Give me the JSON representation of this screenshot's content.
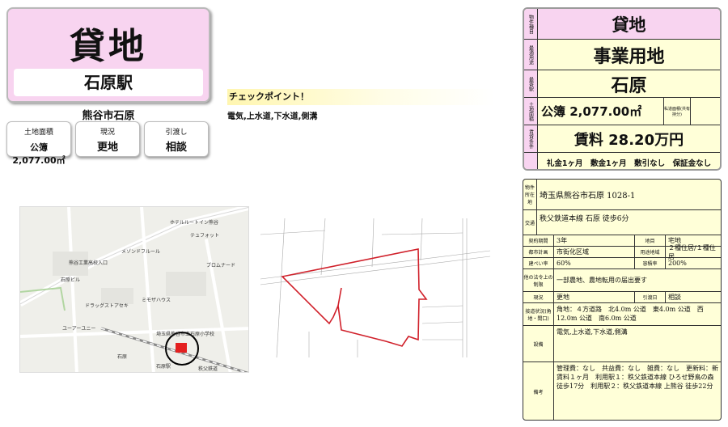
{
  "header": {
    "title": "貸地",
    "station": "石原駅",
    "location": "熊谷市石原"
  },
  "info_boxes": [
    {
      "label": "土地面積",
      "value": "公簿 2,077.00㎡"
    },
    {
      "label": "現況",
      "value": "更地"
    },
    {
      "label": "引渡し",
      "value": "相談"
    }
  ],
  "checkpoint": {
    "title": "チェックポイント！",
    "text": "電気,上水道,下水道,側溝"
  },
  "map_labels": [
    "ホテルルートイン熊谷",
    "テュフォット",
    "熊谷工業高校入口",
    "メゾンドフルール",
    "石原ビル",
    "ドラッグストアセキ",
    "ミモザハウス",
    "ブロムナード",
    "ユーアーユニー",
    "石原",
    "埼玉県熊谷市立石原小学校",
    "秩父鉄道",
    "石原駅"
  ],
  "spec": {
    "rows": [
      {
        "label": "物件種目",
        "value": "貸地"
      },
      {
        "label": "最適用途",
        "value": "事業用地"
      },
      {
        "label": "最寄駅",
        "value": "石原"
      },
      {
        "label": "土地面積",
        "value": "公簿 2,077.00㎡",
        "note": "私道面積(共有持分)"
      },
      {
        "label": "賃貸条件",
        "value": "賃料 28.20万円"
      },
      {
        "label": "",
        "value": "礼金1ヶ月　敷金1ヶ月　敷引なし　保証金なし"
      }
    ]
  },
  "detail": {
    "address_label": "物件所在地",
    "address": "埼玉県熊谷市石原 1028-1",
    "transport_label": "交通",
    "transport": "秩父鉄道本線 石原 徒歩6分",
    "contract_label": "契約期間",
    "contract": "3年",
    "land_label": "地目",
    "land": "宅地",
    "city_plan_label": "都市計画",
    "city_plan": "市街化区域",
    "zoning_label": "用途地域",
    "zoning": "２種住居/１種住居",
    "coverage_label": "建ぺい率",
    "coverage": "60%",
    "floor_ratio_label": "容積率",
    "floor_ratio": "200%",
    "law_label": "他の法令上の制限",
    "law": "一部農地、農地転用の届出要す",
    "status_label": "現況",
    "status": "更地",
    "delivery_label": "引渡日",
    "delivery": "相談",
    "road_label": "接道状況(角地・間口)",
    "road": "角地：４方道路　北4.0m 公道　東4.0m 公道　西12.0m 公道　南6.0m 公道",
    "facility_label": "設備",
    "facility": "電気,上水道,下水道,側溝",
    "remarks_label": "備考",
    "remarks": "管理費：なし　共益費：なし　雑費：なし　更新料：新賃料１ヶ月　利用駅１：秩父鉄道本線 ひろせ野鳥の森 徒歩17分　利用駅２：秩父鉄道本線 上熊谷 徒歩22分"
  },
  "colors": {
    "pink": "#f8d4f0",
    "yellow": "#ffffd8",
    "boundary_red": "#d0202a"
  }
}
